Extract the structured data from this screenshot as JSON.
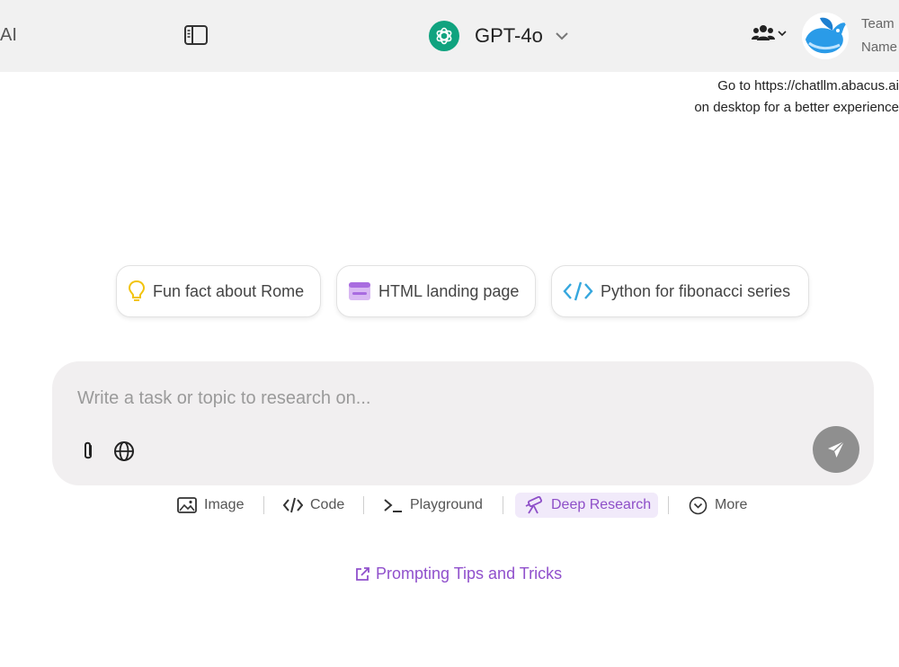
{
  "header": {
    "brand_fragment": "AI",
    "model": {
      "name": "GPT-4o"
    },
    "team_line1": "Team",
    "team_line2": "Name"
  },
  "notice": {
    "line1": "Go to https://chatllm.abacus.ai",
    "line2": "on desktop for a better experience"
  },
  "suggestions": [
    {
      "label": "Fun fact about Rome",
      "icon": "lightbulb-icon"
    },
    {
      "label": "HTML landing page",
      "icon": "browser-window-icon"
    },
    {
      "label": "Python for fibonacci series",
      "icon": "code-icon"
    }
  ],
  "composer": {
    "placeholder": "Write a task or topic to research on..."
  },
  "tools": [
    {
      "label": "Image",
      "icon": "image-icon"
    },
    {
      "label": "Code",
      "icon": "code-icon"
    },
    {
      "label": "Playground",
      "icon": "terminal-icon"
    },
    {
      "label": "Deep Research",
      "icon": "telescope-icon",
      "active": true
    },
    {
      "label": "More",
      "icon": "chevron-circle-icon"
    }
  ],
  "tips_link": "Prompting Tips and Tricks",
  "colors": {
    "header_bg": "#f1f1f1",
    "model_logo": "#10a37f",
    "accent_purple": "#9050cc",
    "composer_bg": "#f1eff0",
    "send_button": "#8f8f8f"
  }
}
